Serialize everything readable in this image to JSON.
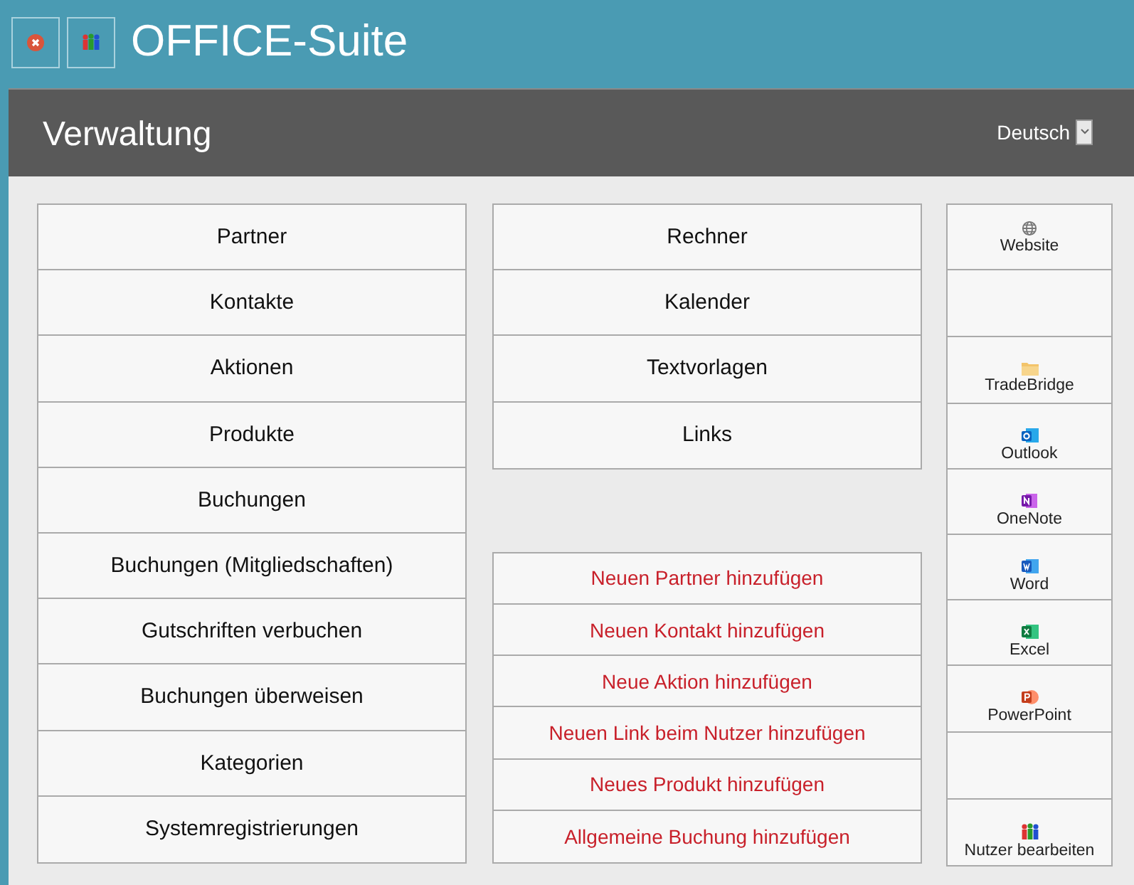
{
  "app": {
    "title": "OFFICE-Suite"
  },
  "header_buttons": [
    {
      "kind": "close"
    },
    {
      "kind": "users"
    }
  ],
  "section": {
    "title": "Verwaltung",
    "language": "Deutsch"
  },
  "menu": [
    {
      "label": "Partner"
    },
    {
      "label": "Kontakte"
    },
    {
      "label": "Aktionen"
    },
    {
      "label": "Produkte"
    },
    {
      "label": "Buchungen"
    },
    {
      "label": "Buchungen (Mitgliedschaften)"
    },
    {
      "label": "Gutschriften verbuchen"
    },
    {
      "label": "Buchungen überweisen"
    },
    {
      "label": "Kategorien"
    },
    {
      "label": "Systemregistrierungen"
    }
  ],
  "tools": [
    {
      "label": "Rechner"
    },
    {
      "label": "Kalender"
    },
    {
      "label": "Textvorlagen"
    },
    {
      "label": "Links"
    }
  ],
  "quick_actions": [
    {
      "label": "Neuen Partner hinzufügen"
    },
    {
      "label": "Neuen Kontakt hinzufügen"
    },
    {
      "label": "Neue Aktion hinzufügen"
    },
    {
      "label": "Neuen Link beim Nutzer hinzufügen"
    },
    {
      "label": "Neues Produkt hinzufügen"
    },
    {
      "label": "Allgemeine Buchung hinzufügen"
    }
  ],
  "apps": [
    {
      "kind": "globe",
      "label": "Website"
    },
    {
      "kind": "empty"
    },
    {
      "kind": "folder",
      "label": "TradeBridge"
    },
    {
      "kind": "outlook",
      "label": "Outlook"
    },
    {
      "kind": "onenote",
      "label": "OneNote"
    },
    {
      "kind": "word",
      "label": "Word"
    },
    {
      "kind": "excel",
      "label": "Excel"
    },
    {
      "kind": "powerpoint",
      "label": "PowerPoint"
    },
    {
      "kind": "empty"
    },
    {
      "kind": "users",
      "label": "Nutzer bearbeiten"
    }
  ]
}
